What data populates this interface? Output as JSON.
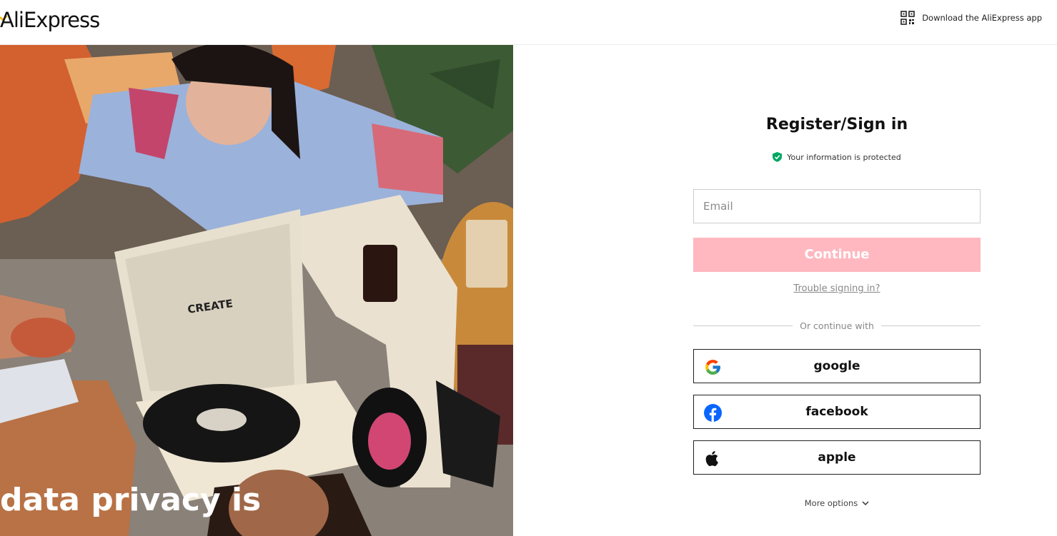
{
  "header": {
    "logo_text": "AliExpress",
    "app_link_label": "Download the AliExpress app"
  },
  "hero": {
    "caption_line1": "data privacy is",
    "caption_line2": "",
    "record_player_brand": "CREATE"
  },
  "form": {
    "title": "Register/Sign in",
    "protected_text": "Your information is protected",
    "email_placeholder": "Email",
    "email_value": "",
    "continue_label": "Continue",
    "trouble_link": "Trouble signing in?",
    "divider_text": "Or continue with",
    "social_buttons": [
      {
        "label": "google",
        "icon": "google-icon"
      },
      {
        "label": "facebook",
        "icon": "facebook-icon"
      },
      {
        "label": "apple",
        "icon": "apple-icon"
      }
    ],
    "more_options": "More options"
  },
  "colors": {
    "continue_bg": "#ffb8c0",
    "shield": "#00a862",
    "facebook": "#0866ff"
  }
}
